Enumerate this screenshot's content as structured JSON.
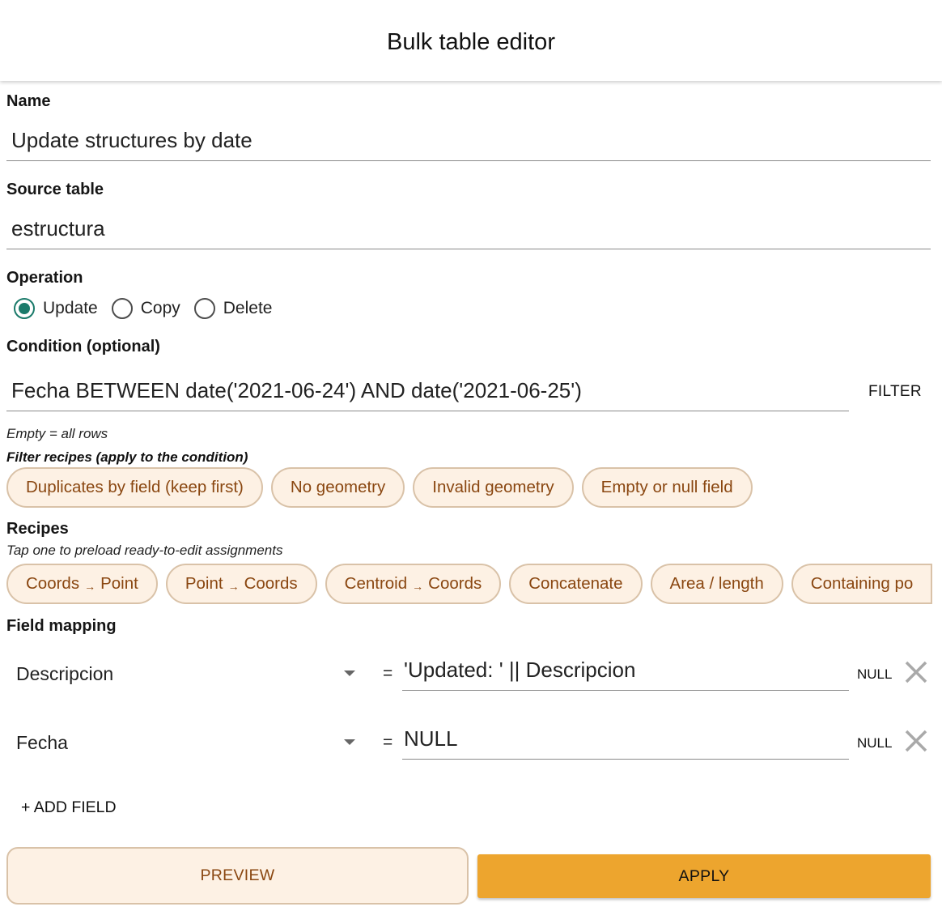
{
  "header": {
    "title": "Bulk table editor"
  },
  "name": {
    "label": "Name",
    "value": "Update structures by date"
  },
  "source_table": {
    "label": "Source table",
    "value": "estructura"
  },
  "operation": {
    "label": "Operation",
    "options": [
      "Update",
      "Copy",
      "Delete"
    ],
    "selected": "Update"
  },
  "condition": {
    "label": "Condition (optional)",
    "value": "Fecha BETWEEN date('2021-06-24') AND date('2021-06-25')",
    "filter_button": "FILTER",
    "hint": "Empty = all rows"
  },
  "filter_recipes": {
    "label": "Filter recipes (apply to the condition)",
    "chips": [
      "Duplicates by field (keep first)",
      "No geometry",
      "Invalid geometry",
      "Empty or null field"
    ]
  },
  "recipes": {
    "label": "Recipes",
    "hint": "Tap one to preload ready-to-edit assignments",
    "chips": [
      {
        "left": "Coords",
        "arrow": "→",
        "right": "Point"
      },
      {
        "left": "Point",
        "arrow": "→",
        "right": "Coords"
      },
      {
        "left": "Centroid",
        "arrow": "→",
        "right": "Coords"
      },
      {
        "left": "Concatenate",
        "arrow": "",
        "right": ""
      },
      {
        "left": "Area / length",
        "arrow": "",
        "right": ""
      },
      {
        "left": "Containing po",
        "arrow": "",
        "right": ""
      }
    ]
  },
  "field_mapping": {
    "label": "Field mapping",
    "rows": [
      {
        "field": "Descripcion",
        "equals": "=",
        "expression": "'Updated: ' || Descripcion",
        "null_label": "NULL"
      },
      {
        "field": "Fecha",
        "equals": "=",
        "expression": "NULL",
        "null_label": "NULL"
      }
    ],
    "add_field": "+ ADD FIELD"
  },
  "actions": {
    "preview": "PREVIEW",
    "apply": "APPLY"
  },
  "colors": {
    "accent": "#eda52e",
    "chip_bg": "#fdf1e4",
    "chip_text": "#8a4711",
    "radio_selected": "#1a7a6a"
  }
}
